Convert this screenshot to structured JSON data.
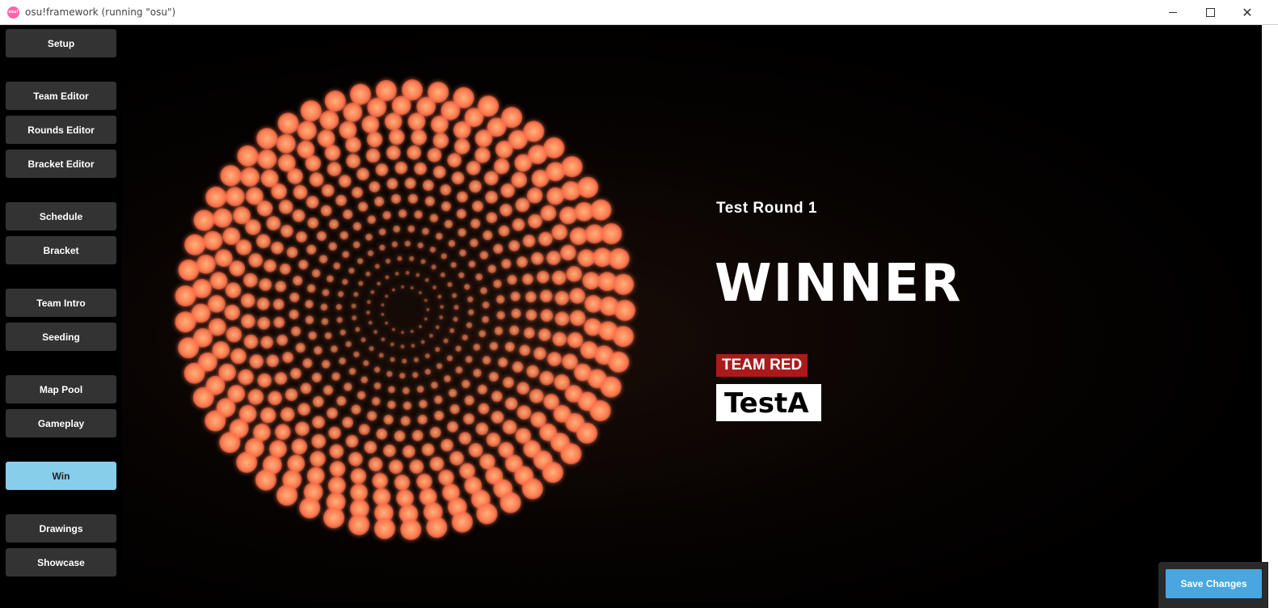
{
  "window": {
    "title": "osu!framework (running \"osu\")",
    "icon_text": "osu!",
    "close_glyph": "✕"
  },
  "sidebar": {
    "items": [
      {
        "label": "Setup",
        "active": false
      },
      {
        "label": "Team Editor",
        "active": false
      },
      {
        "label": "Rounds Editor",
        "active": false
      },
      {
        "label": "Bracket Editor",
        "active": false
      },
      {
        "label": "Schedule",
        "active": false
      },
      {
        "label": "Bracket",
        "active": false
      },
      {
        "label": "Team Intro",
        "active": false
      },
      {
        "label": "Seeding",
        "active": false
      },
      {
        "label": "Map Pool",
        "active": false
      },
      {
        "label": "Gameplay",
        "active": false
      },
      {
        "label": "Win",
        "active": true
      },
      {
        "label": "Drawings",
        "active": false
      },
      {
        "label": "Showcase",
        "active": false
      }
    ]
  },
  "main": {
    "round_name": "Test Round 1",
    "heading": "WINNER",
    "team_tag": "TEAM RED",
    "team_name": "TestA"
  },
  "footer": {
    "save_label": "Save Changes"
  },
  "colors": {
    "active_nav": "#87ceeb",
    "nav_button": "#333333",
    "team_red": "#aa1a1a",
    "save_button": "#4aa6e0",
    "dot_glow": "#ff8a5c"
  },
  "icons": {
    "app": "osu-logo-icon",
    "minimize": "minimize-icon",
    "maximize": "maximize-icon",
    "close": "close-icon",
    "background": "dot-spiral-background"
  }
}
